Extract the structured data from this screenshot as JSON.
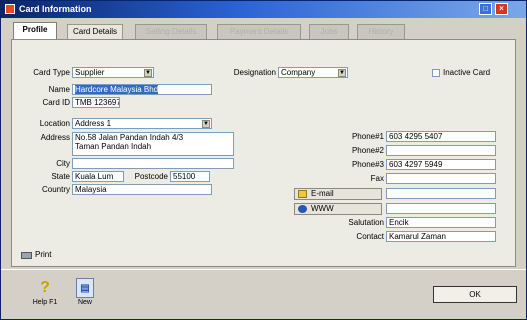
{
  "window": {
    "title": "Card Information"
  },
  "tabs": [
    {
      "label": "Profile",
      "state": "active"
    },
    {
      "label": "Card Details",
      "state": "normal"
    },
    {
      "label": "Selling Details",
      "state": "disabled"
    },
    {
      "label": "Payment Details",
      "state": "disabled"
    },
    {
      "label": "Jobs",
      "state": "disabled"
    },
    {
      "label": "History",
      "state": "disabled"
    }
  ],
  "form": {
    "card_type": {
      "label": "Card Type",
      "value": "Supplier"
    },
    "designation": {
      "label": "Designation",
      "value": "Company"
    },
    "inactive_card": {
      "label": "Inactive Card",
      "checked": false
    },
    "name": {
      "label": "Name",
      "value": "Hardcore Malaysia Bhd"
    },
    "card_id": {
      "label": "Card ID",
      "value": "TMB 123697"
    },
    "location": {
      "label": "Location",
      "value": "Address 1"
    },
    "address": {
      "label": "Address",
      "line1": "No.58 Jalan Pandan Indah 4/3",
      "line2": "Taman Pandan Indah"
    },
    "city": {
      "label": "City",
      "value": ""
    },
    "state": {
      "label": "State",
      "value": "Kuala Lum"
    },
    "postcode": {
      "label": "Postcode",
      "value": "55100"
    },
    "country": {
      "label": "Country",
      "value": "Malaysia"
    },
    "phone1": {
      "label": "Phone#1",
      "value": "603 4295 5407"
    },
    "phone2": {
      "label": "Phone#2",
      "value": ""
    },
    "phone3": {
      "label": "Phone#3",
      "value": "603 4297 5949"
    },
    "fax": {
      "label": "Fax",
      "value": ""
    },
    "email_button": "E-mail",
    "email": {
      "value": ""
    },
    "www_button": "WWW",
    "www": {
      "value": ""
    },
    "salutation": {
      "label": "Salutation",
      "value": "Encik"
    },
    "contact": {
      "label": "Contact",
      "value": "Kamarul Zaman"
    }
  },
  "print_button": "Print",
  "bottom": {
    "help_label": "Help F1",
    "new_label": "New",
    "ok_label": "OK"
  },
  "colors": {
    "titlebar_start": "#0a246a",
    "selection": "#316ac5"
  }
}
